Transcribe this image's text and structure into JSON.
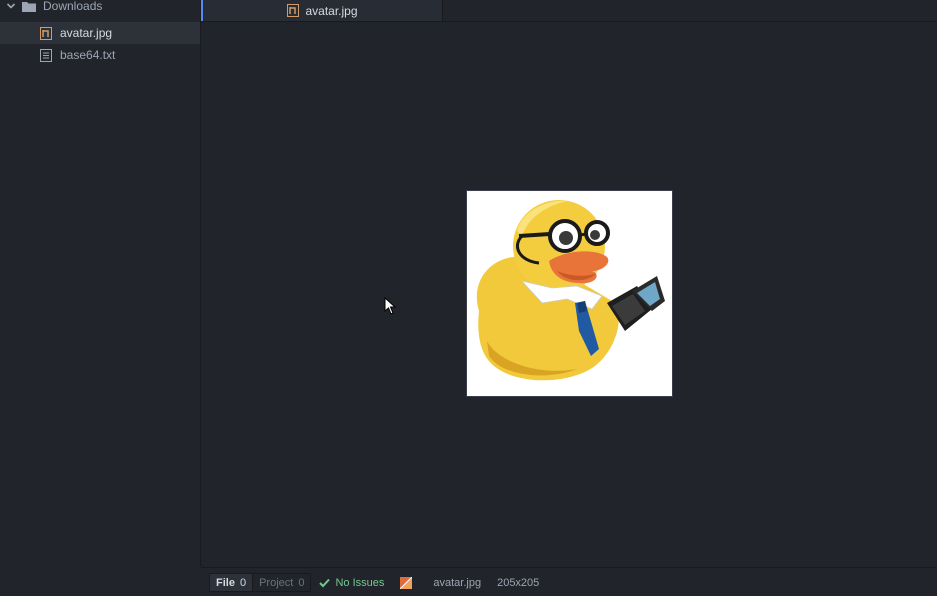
{
  "sidebar": {
    "folder": {
      "label": "Downloads",
      "icon": "folder-icon",
      "expanded": true
    },
    "files": [
      {
        "label": "avatar.jpg",
        "icon": "image-file-icon",
        "selected": true
      },
      {
        "label": "base64.txt",
        "icon": "text-file-icon",
        "selected": false
      }
    ]
  },
  "tabs": [
    {
      "label": "avatar.jpg",
      "icon": "image-file-icon",
      "active": true
    }
  ],
  "viewer": {
    "image_alt": "rubber duck with glasses and laptop",
    "image_subject": "yellow rubber duck wearing glasses, headset, blue tie, holding a laptop"
  },
  "statusbar": {
    "linter": {
      "file_label": "File",
      "file_count": "0",
      "project_label": "Project",
      "project_count": "0",
      "status": "No Issues"
    },
    "file_name": "avatar.jpg",
    "dimensions": "205x205"
  },
  "colors": {
    "background": "#21252b",
    "accent": "#568af2",
    "success": "#73c990",
    "image_icon": "#d19a66"
  }
}
